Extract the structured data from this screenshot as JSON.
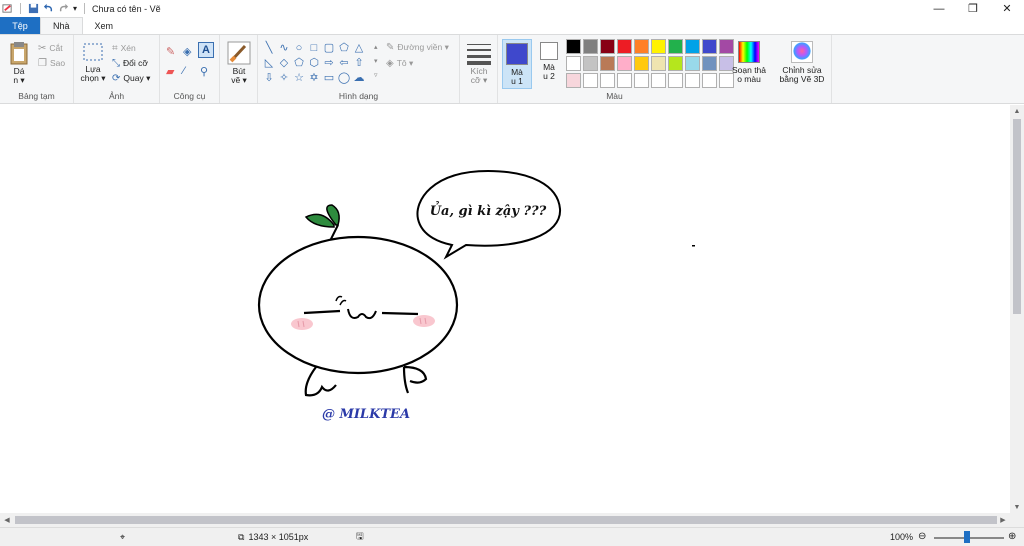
{
  "window": {
    "title": "Chưa có tên - Vẽ"
  },
  "tabs": [
    {
      "label": "Tệp"
    },
    {
      "label": "Nhà"
    },
    {
      "label": "Xem"
    }
  ],
  "ribbon": {
    "clipboard": {
      "label": "Bảng tạm",
      "paste_line1": "Dá",
      "paste_line2": "n ▾",
      "cut": "Cắt",
      "copy": "Sao"
    },
    "image": {
      "label": "Ảnh",
      "select_line1": "Lựa",
      "select_line2": "chọn ▾",
      "crop": "Xén",
      "resize": "Đổi cỡ",
      "rotate": "Quay ▾"
    },
    "tools": {
      "label": "Công cụ"
    },
    "brushes": {
      "line1": "Bút",
      "line2": "vẽ ▾"
    },
    "shapes": {
      "label": "Hình dạng",
      "outline": "Đường viền ▾",
      "fill": "Tô ▾"
    },
    "size": {
      "line1": "Kích",
      "line2": "cỡ ▾"
    },
    "colors": {
      "label": "Màu",
      "color1_line1": "Mà",
      "color1_line2": "u 1",
      "color2_line1": "Mà",
      "color2_line2": "u 2",
      "edit_line1": "Soạn thả",
      "edit_line2": "o màu",
      "paint3d_line1": "Chỉnh sửa",
      "paint3d_line2": "bằng Vẽ 3D",
      "color1_value": "#3f48cc",
      "color2_value": "#ffffff",
      "palette": [
        "#000000",
        "#7f7f7f",
        "#880015",
        "#ed1c24",
        "#ff7f27",
        "#fff200",
        "#22b14c",
        "#00a2e8",
        "#3f48cc",
        "#a349a4",
        "#ffffff",
        "#c3c3c3",
        "#b97a57",
        "#ffaec9",
        "#ffc90e",
        "#efe4b0",
        "#b5e61d",
        "#99d9ea",
        "#7092be",
        "#c8bfe7",
        "#f7d6dc",
        "#ffffff",
        "#ffffff",
        "#ffffff",
        "#ffffff",
        "#ffffff",
        "#ffffff",
        "#ffffff",
        "#ffffff",
        "#ffffff"
      ]
    }
  },
  "drawing": {
    "speech_text": "Ủa, gì kì zậy ???",
    "signature": "@ MILKTEA"
  },
  "status": {
    "dimensions": "1343 × 1051px",
    "zoom": "100%"
  }
}
